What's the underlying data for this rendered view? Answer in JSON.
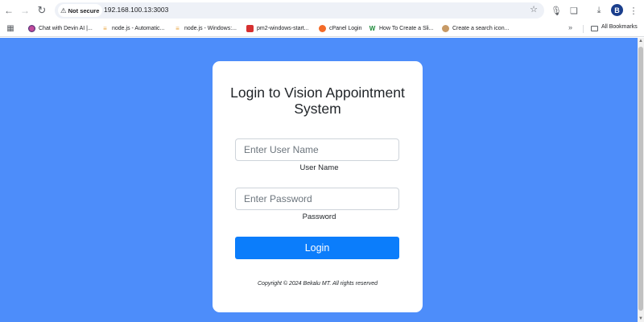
{
  "browser": {
    "security_label": "Not secure",
    "url": "192.168.100.13:3003",
    "profile_initial": "B",
    "bookmarks": [
      {
        "label": "Chat with Devin AI |..."
      },
      {
        "label": "node.js - Automatic..."
      },
      {
        "label": "node.js - Windows:..."
      },
      {
        "label": "pm2-windows-start..."
      },
      {
        "label": "cPanel Login"
      },
      {
        "label": "How To Create a Sli..."
      },
      {
        "label": "Create a search icon..."
      }
    ],
    "all_bookmarks_label": "All Bookmarks",
    "icons": [
      "back-arrow-icon",
      "forward-arrow-icon",
      "reload-icon",
      "warning-icon",
      "star-icon",
      "microphone-icon",
      "extensions-icon",
      "download-icon",
      "kebab-menu-icon",
      "apps-grid-icon",
      "folder-icon"
    ]
  },
  "page": {
    "background_color": "#4d8dfa",
    "title": "Login to Vision Appointment System",
    "username_placeholder": "Enter User Name",
    "username_label": "User Name",
    "password_placeholder": "Enter Password",
    "password_label": "Password",
    "login_label": "Login",
    "login_color": "#0b7dfb",
    "copyright": "Copyright © 2024 Bekalu MT. All rights reserved"
  }
}
